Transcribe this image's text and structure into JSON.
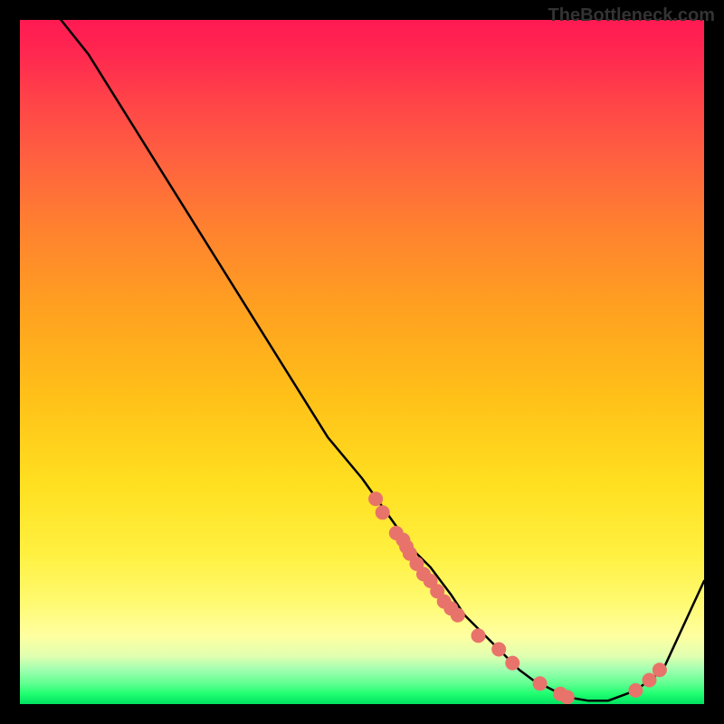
{
  "watermark": "TheBottleneck.com",
  "chart_data": {
    "type": "line",
    "title": "",
    "xlabel": "",
    "ylabel": "",
    "xlim": [
      0,
      100
    ],
    "ylim": [
      0,
      100
    ],
    "series": [
      {
        "name": "bottleneck-curve",
        "x": [
          6,
          10,
          15,
          20,
          25,
          30,
          35,
          40,
          45,
          50,
          55,
          58,
          60,
          63,
          65,
          68,
          70,
          73,
          75,
          78,
          80,
          83,
          86,
          90,
          94,
          100
        ],
        "y": [
          100,
          95,
          87,
          79,
          71,
          63,
          55,
          47,
          39,
          33,
          26,
          22,
          20,
          16,
          13,
          10,
          8,
          5,
          3.5,
          2,
          1,
          0.5,
          0.5,
          2,
          5,
          18
        ]
      }
    ],
    "scatter_points": {
      "name": "data-points",
      "x": [
        52,
        53,
        55,
        56,
        56.5,
        57,
        58,
        59,
        60,
        61,
        62,
        63,
        64,
        67,
        70,
        72,
        76,
        79,
        80,
        90,
        92,
        93.5
      ],
      "y": [
        30,
        28,
        25,
        24,
        23,
        22,
        20.5,
        19,
        18,
        16.5,
        15,
        14,
        13,
        10,
        8,
        6,
        3,
        1.5,
        1,
        2,
        3.5,
        5
      ],
      "color": "#e8736b",
      "radius": 8
    },
    "background_gradient": {
      "type": "vertical",
      "stops": [
        {
          "pos": 0,
          "color": "#ff1a52"
        },
        {
          "pos": 50,
          "color": "#ffb020"
        },
        {
          "pos": 90,
          "color": "#ffff80"
        },
        {
          "pos": 100,
          "color": "#00e060"
        }
      ]
    }
  }
}
